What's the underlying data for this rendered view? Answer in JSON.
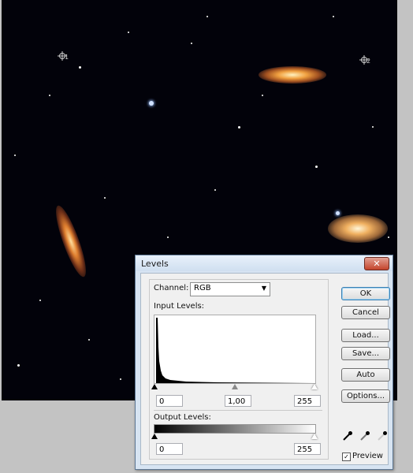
{
  "dialog": {
    "title": "Levels",
    "close": "✕",
    "channel_label": "Channel:",
    "channel_value": "RGB",
    "input_levels_label": "Input Levels:",
    "input_black": "0",
    "input_gamma": "1,00",
    "input_white": "255",
    "output_levels_label": "Output Levels:",
    "output_black": "0",
    "output_white": "255",
    "buttons": {
      "ok": "OK",
      "cancel": "Cancel",
      "load": "Load...",
      "save": "Save...",
      "auto": "Auto",
      "options": "Options..."
    },
    "preview_label": "Preview",
    "preview_checked": "✓"
  },
  "image": {
    "sampler_1": "1",
    "sampler_2": "2"
  }
}
